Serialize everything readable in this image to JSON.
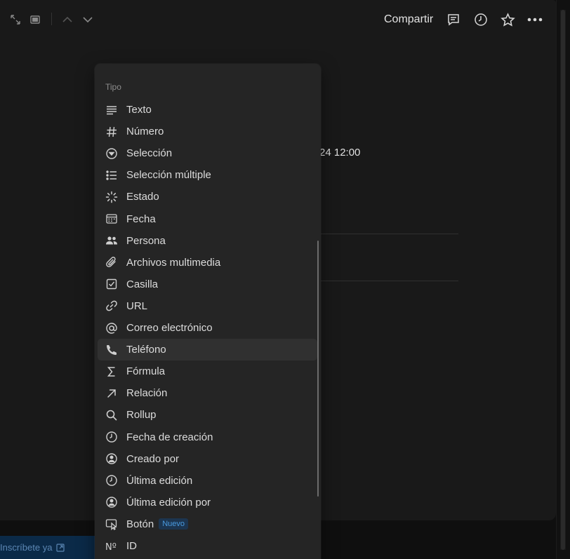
{
  "topbar": {
    "share_label": "Compartir",
    "left_icons": [
      "expand-icon",
      "sidebar-icon",
      "chevron-up-icon",
      "chevron-down-icon"
    ],
    "right_icons": [
      "comment-icon",
      "clock-icon",
      "star-icon",
      "more-icon"
    ]
  },
  "background": {
    "datetime_fragment": "24 12:00"
  },
  "signup": {
    "label": "Inscríbete ya"
  },
  "menu": {
    "title": "Tipo",
    "items": [
      {
        "label": "Texto",
        "icon": "text-lines-icon"
      },
      {
        "label": "Número",
        "icon": "hash-icon"
      },
      {
        "label": "Selección",
        "icon": "select-icon"
      },
      {
        "label": "Selección múltiple",
        "icon": "list-icon"
      },
      {
        "label": "Estado",
        "icon": "status-icon"
      },
      {
        "label": "Fecha",
        "icon": "calendar-icon"
      },
      {
        "label": "Persona",
        "icon": "people-icon"
      },
      {
        "label": "Archivos multimedia",
        "icon": "paperclip-icon"
      },
      {
        "label": "Casilla",
        "icon": "checkbox-icon"
      },
      {
        "label": "URL",
        "icon": "link-icon"
      },
      {
        "label": "Correo electrónico",
        "icon": "at-icon"
      },
      {
        "label": "Teléfono",
        "icon": "phone-icon"
      },
      {
        "label": "Fórmula",
        "icon": "sigma-icon"
      },
      {
        "label": "Relación",
        "icon": "arrow-up-right-icon"
      },
      {
        "label": "Rollup",
        "icon": "magnifier-icon"
      },
      {
        "label": "Fecha de creación",
        "icon": "clock-icon"
      },
      {
        "label": "Creado por",
        "icon": "user-circle-icon"
      },
      {
        "label": "Última edición",
        "icon": "clock-icon"
      },
      {
        "label": "Última edición por",
        "icon": "user-circle-icon"
      },
      {
        "label": "Botón",
        "icon": "cursor-icon",
        "badge": "Nuevo"
      },
      {
        "label": "ID",
        "icon": "numero-icon"
      }
    ],
    "hover_index": 11
  }
}
